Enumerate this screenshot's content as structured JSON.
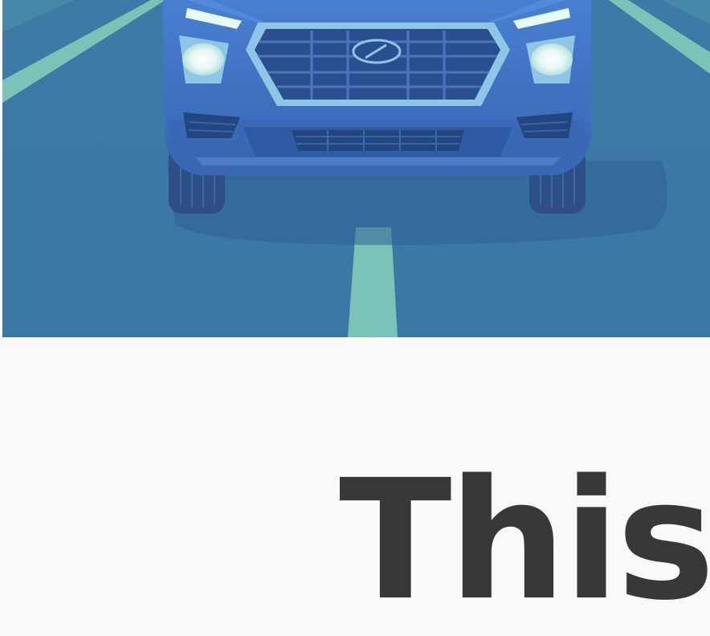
{
  "hero": {
    "image_name": "blue-suv-front-on-highway-illustration"
  },
  "headline": {
    "text": "This r"
  },
  "colors": {
    "page_background": "#faf9f7",
    "headline_text": "#383838",
    "road": "#3f7ba1",
    "lane_marking": "#7cc3b7",
    "car_body": "#3f6fc2",
    "grille": "#2a4f8e"
  }
}
